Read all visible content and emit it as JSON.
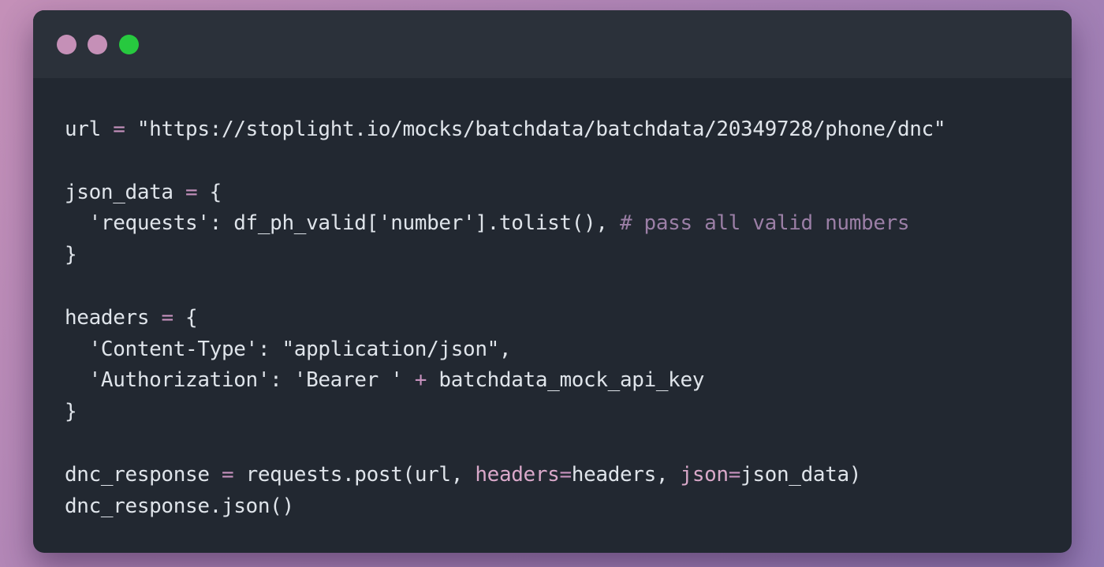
{
  "window": {
    "controls": [
      {
        "name": "close",
        "color": "#c590b7"
      },
      {
        "name": "minimize",
        "color": "#c590b7"
      },
      {
        "name": "maximize",
        "color": "#27c93f"
      }
    ]
  },
  "code": {
    "l1": {
      "a": "url ",
      "op": "=",
      "b": " \"https://stoplight.io/mocks/batchdata/batchdata/20349728/phone/dnc\""
    },
    "l3": {
      "a": "json_data ",
      "op": "=",
      "b": " {"
    },
    "l4": {
      "a": "  'requests': df_ph_valid['number'].tolist(), ",
      "comment": "# pass all valid numbers"
    },
    "l5": "}",
    "l7": {
      "a": "headers ",
      "op": "=",
      "b": " {"
    },
    "l8": "  'Content-Type': \"application/json\",",
    "l9": {
      "a": "  'Authorization': 'Bearer ' ",
      "op": "+",
      "b": " batchdata_mock_api_key"
    },
    "l10": "}",
    "l12": {
      "a": "dnc_response ",
      "op": "=",
      "b": " requests.post(url, ",
      "kw1": "headers",
      "op2": "=",
      "c": "headers, ",
      "kw2": "json",
      "op3": "=",
      "d": "json_data)"
    },
    "l13": "dnc_response.json()"
  }
}
